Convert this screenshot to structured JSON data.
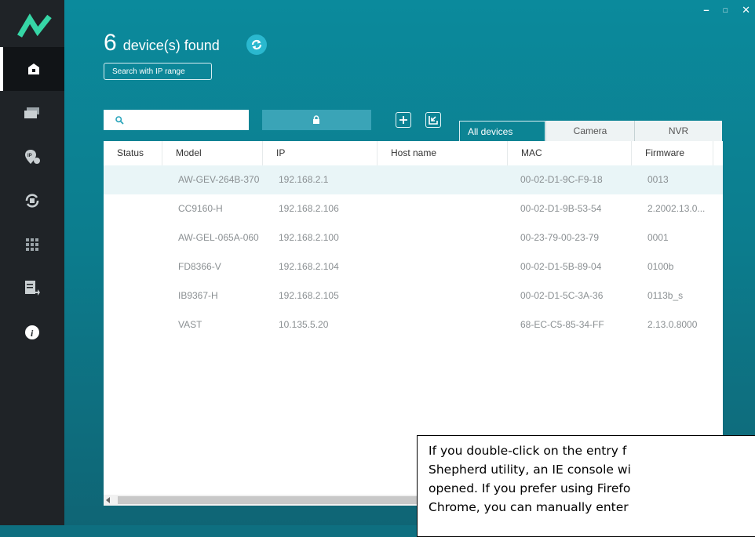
{
  "window": {
    "controls": [
      "–",
      "□",
      "✕"
    ]
  },
  "sidebar": {
    "items": [
      {
        "icon": "home-icon",
        "active": true
      },
      {
        "icon": "devices-icon"
      },
      {
        "icon": "ip-pin-icon"
      },
      {
        "icon": "sync-icon"
      },
      {
        "icon": "grid-icon"
      },
      {
        "icon": "report-export-icon"
      },
      {
        "icon": "info-icon"
      }
    ]
  },
  "header": {
    "count": "6",
    "label": "device(s) found",
    "search_range_label": "Search with IP range"
  },
  "toolbar": {
    "search_placeholder": "",
    "lock_icon": "lock-icon",
    "add_icon": "plus-icon",
    "export_icon": "import-icon"
  },
  "tabs": [
    {
      "label": "All devices",
      "active": true
    },
    {
      "label": "Camera"
    },
    {
      "label": "NVR"
    }
  ],
  "table": {
    "columns": [
      "Status",
      "Model",
      "IP",
      "Host name",
      "MAC",
      "Firmware"
    ],
    "rows": [
      {
        "status": "",
        "model": "AW-GEV-264B-370",
        "ip": "192.168.2.1",
        "host": "",
        "mac": "00-02-D1-9C-F9-18",
        "firmware": "0013"
      },
      {
        "status": "",
        "model": "CC9160-H",
        "ip": "192.168.2.106",
        "host": "",
        "mac": "00-02-D1-9B-53-54",
        "firmware": "2.2002.13.0..."
      },
      {
        "status": "",
        "model": "AW-GEL-065A-060",
        "ip": "192.168.2.100",
        "host": "",
        "mac": "00-23-79-00-23-79",
        "firmware": "0001"
      },
      {
        "status": "",
        "model": "FD8366-V",
        "ip": "192.168.2.104",
        "host": "",
        "mac": "00-02-D1-5B-89-04",
        "firmware": "0100b"
      },
      {
        "status": "",
        "model": "IB9367-H",
        "ip": "192.168.2.105",
        "host": "",
        "mac": "00-02-D1-5C-3A-36",
        "firmware": "0113b_s"
      },
      {
        "status": "",
        "model": "VAST",
        "ip": "10.135.5.20",
        "host": "",
        "mac": "68-EC-C5-85-34-FF",
        "firmware": "2.13.0.8000"
      }
    ]
  },
  "callout": {
    "lines": [
      "If you double-click on the entry f",
      "Shepherd utility, an IE console wi",
      "opened. If you prefer using Firefo",
      "Chrome, you can manually enter"
    ]
  },
  "colors": {
    "accent": "#0b8a9c",
    "sidebar": "#1f2327",
    "logo": "#36d6a6"
  }
}
